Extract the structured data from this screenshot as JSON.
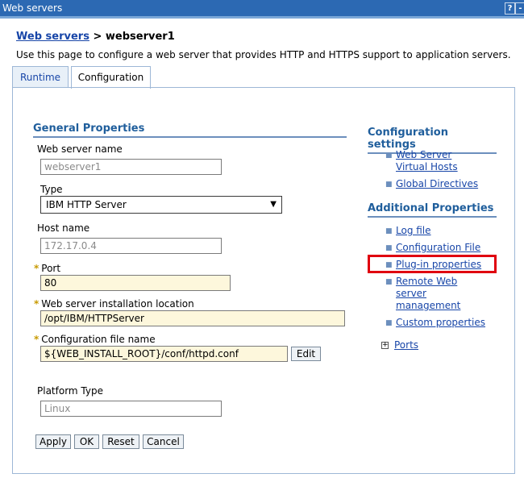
{
  "window": {
    "title": "Web servers",
    "help_label": "?",
    "minimize_label": "-"
  },
  "breadcrumb": {
    "parent": "Web servers",
    "separator": ">",
    "current": "webserver1"
  },
  "description": "Use this page to configure a web server that provides HTTP and HTTPS support to application servers.",
  "tabs": {
    "runtime": "Runtime",
    "configuration": "Configuration"
  },
  "general": {
    "heading": "General Properties",
    "name_label": "Web server name",
    "name_value": "webserver1",
    "type_label": "Type",
    "type_value": "IBM HTTP Server",
    "host_label": "Host name",
    "host_value": "172.17.0.4",
    "port_label": "Port",
    "port_value": "80",
    "install_label": "Web server installation location",
    "install_value": "/opt/IBM/HTTPServer",
    "config_label": "Configuration file name",
    "config_value": "${WEB_INSTALL_ROOT}/conf/httpd.conf",
    "edit_label": "Edit",
    "platform_label": "Platform Type",
    "platform_value": "Linux",
    "required_mark": "*"
  },
  "buttons": {
    "apply": "Apply",
    "ok": "OK",
    "reset": "Reset",
    "cancel": "Cancel"
  },
  "config_settings": {
    "heading": "Configuration settings",
    "vhosts_l1": "Web Server",
    "vhosts_l2": "Virtual Hosts",
    "global": "Global Directives"
  },
  "additional": {
    "heading": "Additional Properties",
    "log": "Log file",
    "config_file": "Configuration File",
    "plugin": "Plug-in properties",
    "remote_l1": "Remote Web",
    "remote_l2": "server",
    "remote_l3": "management",
    "custom": "Custom properties",
    "ports": "Ports",
    "expand_mark": "+"
  },
  "colors": {
    "highlight": "#e0000f",
    "title_bar": "#2c69b3",
    "link": "#1846a8"
  }
}
